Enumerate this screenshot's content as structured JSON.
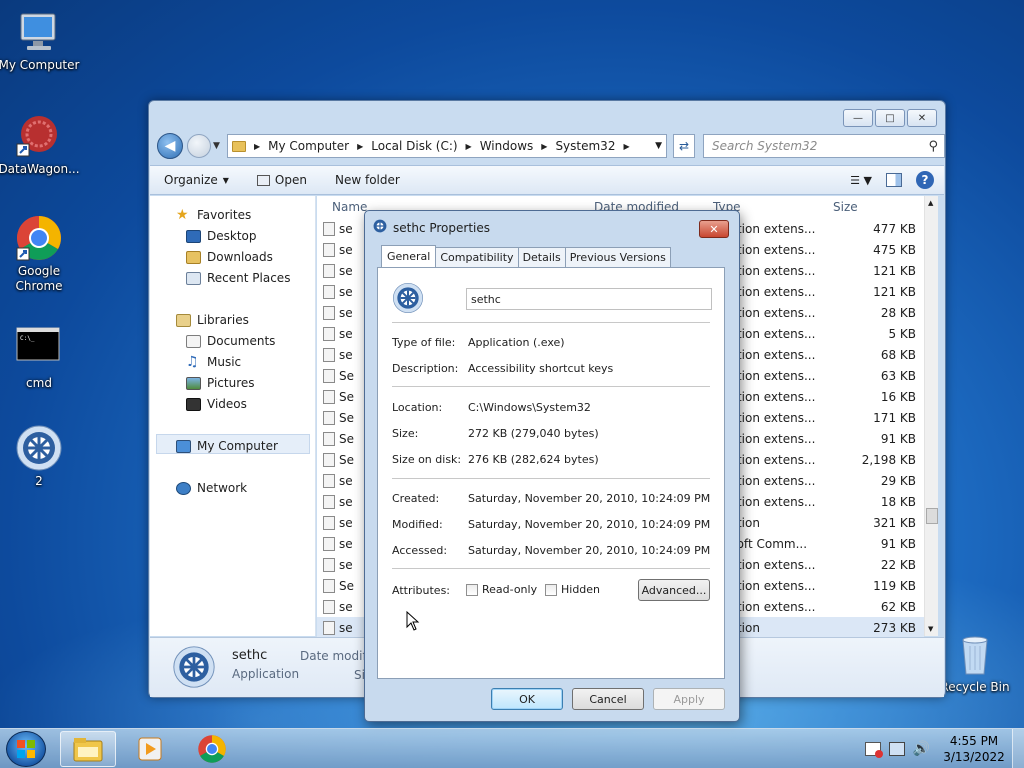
{
  "desktop": {
    "icons": [
      {
        "label": "My Computer"
      },
      {
        "label": "DataWagon..."
      },
      {
        "label": "Google Chrome"
      },
      {
        "label": "cmd"
      },
      {
        "label": "2"
      },
      {
        "label": "Recycle Bin"
      }
    ]
  },
  "explorer": {
    "breadcrumb": [
      "My Computer",
      "Local Disk (C:)",
      "Windows",
      "System32"
    ],
    "search_placeholder": "Search System32",
    "toolbar": {
      "organize": "Organize",
      "open": "Open",
      "new_folder": "New folder"
    },
    "nav": {
      "favorites": "Favorites",
      "desktop": "Desktop",
      "downloads": "Downloads",
      "recent": "Recent Places",
      "libraries": "Libraries",
      "documents": "Documents",
      "music": "Music",
      "pictures": "Pictures",
      "videos": "Videos",
      "mycomputer": "My Computer",
      "network": "Network"
    },
    "columns": {
      "name": "Name",
      "date": "Date modified",
      "type": "Type",
      "size": "Size"
    },
    "rows": [
      {
        "name": "se",
        "type": "cation extens...",
        "size": "477 KB"
      },
      {
        "name": "se",
        "type": "cation extens...",
        "size": "475 KB"
      },
      {
        "name": "se",
        "type": "cation extens...",
        "size": "121 KB"
      },
      {
        "name": "se",
        "type": "cation extens...",
        "size": "121 KB"
      },
      {
        "name": "se",
        "type": "cation extens...",
        "size": "28 KB"
      },
      {
        "name": "se",
        "type": "cation extens...",
        "size": "5 KB"
      },
      {
        "name": "se",
        "type": "cation extens...",
        "size": "68 KB"
      },
      {
        "name": "Se",
        "type": "cation extens...",
        "size": "63 KB"
      },
      {
        "name": "Se",
        "type": "cation extens...",
        "size": "16 KB"
      },
      {
        "name": "Se",
        "type": "cation extens...",
        "size": "171 KB"
      },
      {
        "name": "Se",
        "type": "cation extens...",
        "size": "91 KB"
      },
      {
        "name": "Se",
        "type": "cation extens...",
        "size": "2,198 KB"
      },
      {
        "name": "se",
        "type": "cation extens...",
        "size": "29 KB"
      },
      {
        "name": "se",
        "type": "cation extens...",
        "size": "18 KB"
      },
      {
        "name": "se",
        "type": "cation",
        "size": "321 KB"
      },
      {
        "name": "se",
        "type": "osoft Comm...",
        "size": "91 KB"
      },
      {
        "name": "se",
        "type": "cation extens...",
        "size": "22 KB"
      },
      {
        "name": "Se",
        "type": "cation extens...",
        "size": "119 KB"
      },
      {
        "name": "se",
        "type": "cation extens...",
        "size": "62 KB"
      },
      {
        "name": "se",
        "type": "cation",
        "size": "273 KB"
      }
    ],
    "details": {
      "name": "sethc",
      "type": "Application",
      "date_label": "Date modifi",
      "size_label": "Si"
    }
  },
  "props": {
    "title": "sethc Properties",
    "tabs": [
      "General",
      "Compatibility",
      "Details",
      "Previous Versions"
    ],
    "name_value": "sethc",
    "type_label": "Type of file:",
    "type_value": "Application (.exe)",
    "desc_label": "Description:",
    "desc_value": "Accessibility shortcut keys",
    "loc_label": "Location:",
    "loc_value": "C:\\Windows\\System32",
    "size_label": "Size:",
    "size_value": "272 KB (279,040 bytes)",
    "disk_label": "Size on disk:",
    "disk_value": "276 KB (282,624 bytes)",
    "created_label": "Created:",
    "created_value": "Saturday, November 20, 2010, 10:24:09 PM",
    "modified_label": "Modified:",
    "modified_value": "Saturday, November 20, 2010, 10:24:09 PM",
    "accessed_label": "Accessed:",
    "accessed_value": "Saturday, November 20, 2010, 10:24:09 PM",
    "attr_label": "Attributes:",
    "readonly": "Read-only",
    "hidden": "Hidden",
    "advanced": "Advanced...",
    "ok": "OK",
    "cancel": "Cancel",
    "apply": "Apply"
  },
  "taskbar": {
    "time": "4:55 PM",
    "date": "3/13/2022"
  },
  "colors": {
    "selection": "#dbe7f6",
    "accent": "#2f66b5"
  }
}
